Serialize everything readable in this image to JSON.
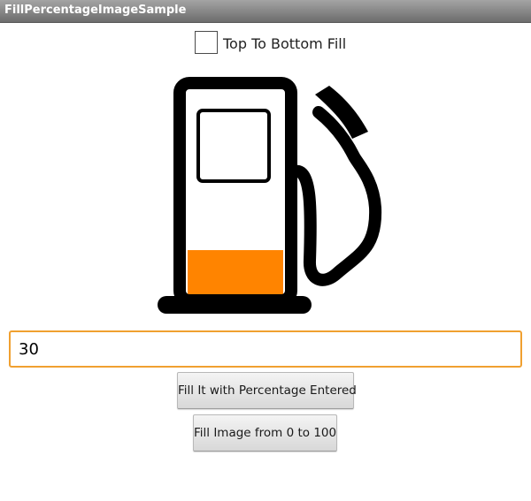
{
  "app": {
    "title": "FillPercentageImageSample"
  },
  "checkbox": {
    "label": "Top To Bottom Fill",
    "checked": false
  },
  "image": {
    "icon": "fuel-pump-icon",
    "fill_percent": 30,
    "fill_direction": "bottom-to-top",
    "fill_color": "#ff8400"
  },
  "input": {
    "value": "30"
  },
  "buttons": {
    "fill_label": "Fill It with Percentage Entered",
    "range_label": "Fill Image from 0 to 100"
  },
  "colors": {
    "accent": "#f0a030",
    "fill": "#ff8400",
    "titlebar": "#8a8a8a"
  }
}
